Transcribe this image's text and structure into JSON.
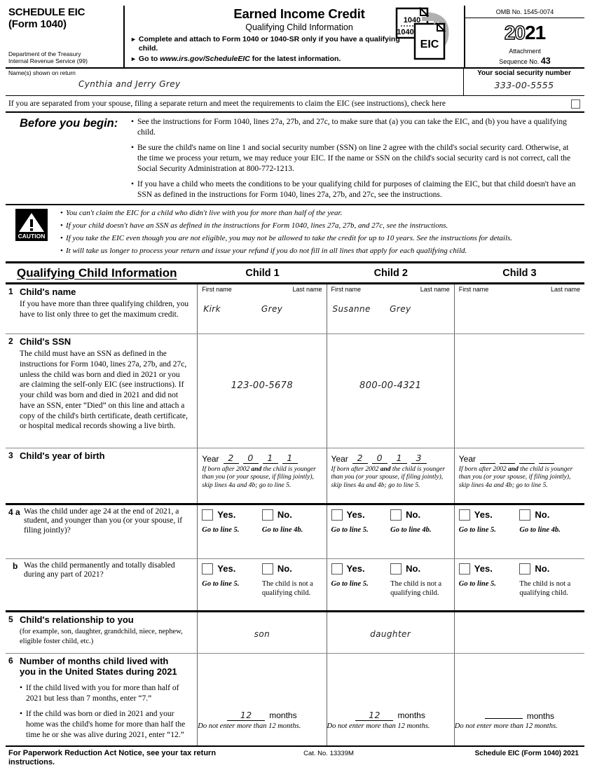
{
  "header": {
    "schedule_title": "SCHEDULE EIC",
    "schedule_form": "(Form 1040)",
    "dept_line1": "Department of the Treasury",
    "dept_line2": "Internal Revenue Service (99)",
    "main_title": "Earned Income Credit",
    "sub_title": "Qualifying Child Information",
    "instruction_1": "Complete and attach to Form 1040 or 1040-SR only if you have a qualifying child.",
    "instruction_2_pre": "Go to",
    "instruction_2_url": "www.irs.gov/ScheduleEIC",
    "instruction_2_post": "for the latest information.",
    "icon_form_1040": "1040",
    "icon_form_1040sr": "1040-SR",
    "icon_eic": "EIC",
    "omb": "OMB No. 1545-0074",
    "year_prefix": "20",
    "year_suffix": "21",
    "attachment_label_1": "Attachment",
    "attachment_label_2": "Sequence No.",
    "attachment_number": "43"
  },
  "name_row": {
    "name_label": "Name(s) shown on return",
    "name_value": "Cynthia and Jerry Grey",
    "ssn_label": "Your social security number",
    "ssn_value": "333-00-5555"
  },
  "separated": {
    "text": "If you are separated from your spouse, filing a separate return and meet the requirements to claim the EIC (see instructions), check here",
    "checked": false
  },
  "before_you_begin": {
    "label": "Before you begin:",
    "items": [
      "See the instructions for Form 1040, lines 27a, 27b, and 27c, to make sure that (a) you can take the EIC, and (b) you have a qualifying child.",
      "Be sure the child's name on line 1 and social security number (SSN) on line 2 agree with the child's social security card. Otherwise, at the time we process your return, we may reduce your EIC. If the name or SSN on the child's social security card is not correct, call the Social Security Administration at 800-772-1213.",
      "If you have a child who meets the conditions to be your qualifying child for purposes of claiming the EIC, but that child doesn't have an SSN as defined in the instructions for Form 1040, lines 27a, 27b, and 27c, see the instructions."
    ]
  },
  "caution": {
    "icon_label": "CAUTION",
    "items": [
      "You can't claim the EIC for a child who didn't live with you for more than half of the year.",
      "If your child doesn't have an SSN as defined in the instructions for Form 1040, lines 27a, 27b, and 27c, see the instructions.",
      "If you take the EIC even though you are not eligible, you may not be allowed to take the credit for up to 10 years. See the instructions for details.",
      "It will take us longer to process your return and issue your refund if you do not fill in all lines that apply for each qualifying child."
    ]
  },
  "table": {
    "section_title": "Qualifying Child Information",
    "child_headers": [
      "Child 1",
      "Child 2",
      "Child 3"
    ],
    "row1": {
      "num": "1",
      "label": "Child's name",
      "sub": "If you have more than three qualifying children, you have to list only three to get the maximum credit.",
      "first_name_label": "First name",
      "last_name_label": "Last name",
      "values": [
        {
          "first": "Kirk",
          "last": "Grey"
        },
        {
          "first": "Susanne",
          "last": "Grey"
        },
        {
          "first": "",
          "last": ""
        }
      ]
    },
    "row2": {
      "num": "2",
      "label": "Child's SSN",
      "sub": "The child must have an SSN as defined in the instructions for Form 1040, lines 27a, 27b, and 27c, unless the child was born and died in 2021 or you are claiming the self-only EIC (see instructions). If your child was born and died in 2021 and did not have an SSN, enter “Died” on this line and attach a copy of the child's birth certificate, death certificate, or hospital medical records showing a live birth.",
      "values": [
        "123-00-5678",
        "800-00-4321",
        ""
      ]
    },
    "row3": {
      "num": "3",
      "label": "Child's year of birth",
      "year_label": "Year",
      "note_pre": "If born after 2002",
      "note_and": "and",
      "note_post": "the child is younger than you (or your spouse, if filing jointly), skip lines 4a and 4b; go to line 5.",
      "values": [
        [
          "2",
          "0",
          "1",
          "1"
        ],
        [
          "2",
          "0",
          "1",
          "3"
        ],
        [
          "",
          "",
          "",
          ""
        ]
      ]
    },
    "row4a": {
      "num": "4 a",
      "label": "Was the child under age 24 at the end of 2021, a student, and younger than you (or your spouse, if filing jointly)?",
      "yes_label": "Yes.",
      "no_label": "No.",
      "yes_note": "Go to line 5.",
      "no_note": "Go to line 4b.",
      "yes_checked": [
        false,
        false,
        false
      ],
      "no_checked": [
        false,
        false,
        false
      ]
    },
    "row4b": {
      "num": "b",
      "label": "Was the child permanently and totally disabled during any part of 2021?",
      "yes_label": "Yes.",
      "no_label": "No.",
      "yes_note": "Go to line 5.",
      "no_note": "The child is not a qualifying child.",
      "yes_checked": [
        false,
        false,
        false
      ],
      "no_checked": [
        false,
        false,
        false
      ]
    },
    "row5": {
      "num": "5",
      "label": "Child's relationship to you",
      "sub": "(for example, son, daughter, grandchild, niece, nephew, eligible foster child, etc.)",
      "values": [
        "son",
        "daughter",
        ""
      ]
    },
    "row6": {
      "num": "6",
      "label": "Number of months child lived with you in the United States during 2021",
      "bullet1": "If the child lived with you for more than half of 2021 but less than 7 months, enter “7.”",
      "bullet2": "If the child was born or died in 2021 and your home was the child's home for more than half the time he or she was alive during 2021, enter “12.”",
      "months_label": "months",
      "months_note": "Do not enter more than 12 months.",
      "values": [
        "12",
        "12",
        ""
      ]
    }
  },
  "footer": {
    "left": "For Paperwork Reduction Act Notice, see your tax return instructions.",
    "center": "Cat. No. 13339M",
    "right": "Schedule EIC (Form 1040) 2021"
  }
}
